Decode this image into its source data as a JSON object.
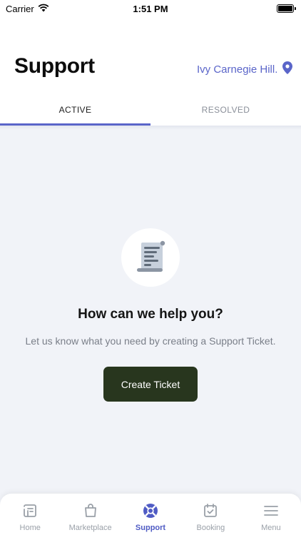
{
  "status_bar": {
    "carrier": "Carrier",
    "time": "1:51 PM"
  },
  "header": {
    "title": "Support",
    "location": "Ivy Carnegie Hill..."
  },
  "tabs": [
    {
      "label": "ACTIVE",
      "active": true
    },
    {
      "label": "RESOLVED",
      "active": false
    }
  ],
  "empty_state": {
    "title": "How can we help you?",
    "subtitle": "Let us know what you need by creating a Support Ticket.",
    "button_label": "Create Ticket",
    "icon": "document-scroll-icon"
  },
  "bottom_nav": {
    "items": [
      {
        "label": "Home",
        "icon": "home-icon",
        "active": false
      },
      {
        "label": "Marketplace",
        "icon": "shopping-bag-icon",
        "active": false
      },
      {
        "label": "Support",
        "icon": "lifebuoy-icon",
        "active": true
      },
      {
        "label": "Booking",
        "icon": "calendar-check-icon",
        "active": false
      },
      {
        "label": "Menu",
        "icon": "menu-icon",
        "active": false
      }
    ]
  },
  "colors": {
    "accent": "#5a65c9",
    "button": "#28361e",
    "background": "#f1f3f8"
  }
}
